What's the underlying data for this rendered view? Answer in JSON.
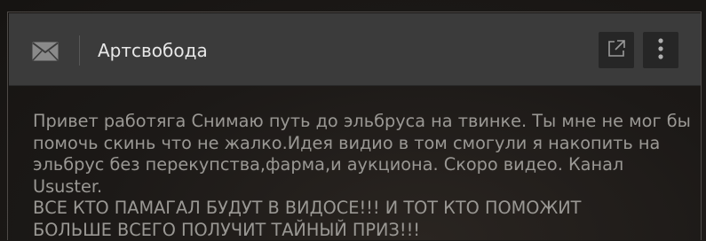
{
  "window": {
    "title": "Артсвобода"
  },
  "icons": {
    "mail": "envelope-icon",
    "open_external": "external-link-icon",
    "more": "vertical-dots-icon"
  },
  "message": {
    "body": "Привет работяга Снимаю путь до эльбруса на твинке. Ты мне не мог бы\nпомочь скинь что не жалко.Идея видио в том смогули я накопить на\nэльбрус без перекупства,фарма,и аукциона. Скоро видео. Канал Ususter.\nВСЕ КТО ПАМАГАЛ БУДУТ В ВИДОСЕ!!! И ТОТ КТО ПОМОЖИТ\nБОЛЬШЕ ВСЕГО ПОЛУЧИТ ТАЙНЫЙ ПРИЗ!!!"
  },
  "colors": {
    "header_bg": "#3b3b3b",
    "button_bg": "#262626",
    "title_text": "#e8e8e8",
    "body_text": "#9a9894",
    "icon": "#8a8a8a"
  }
}
